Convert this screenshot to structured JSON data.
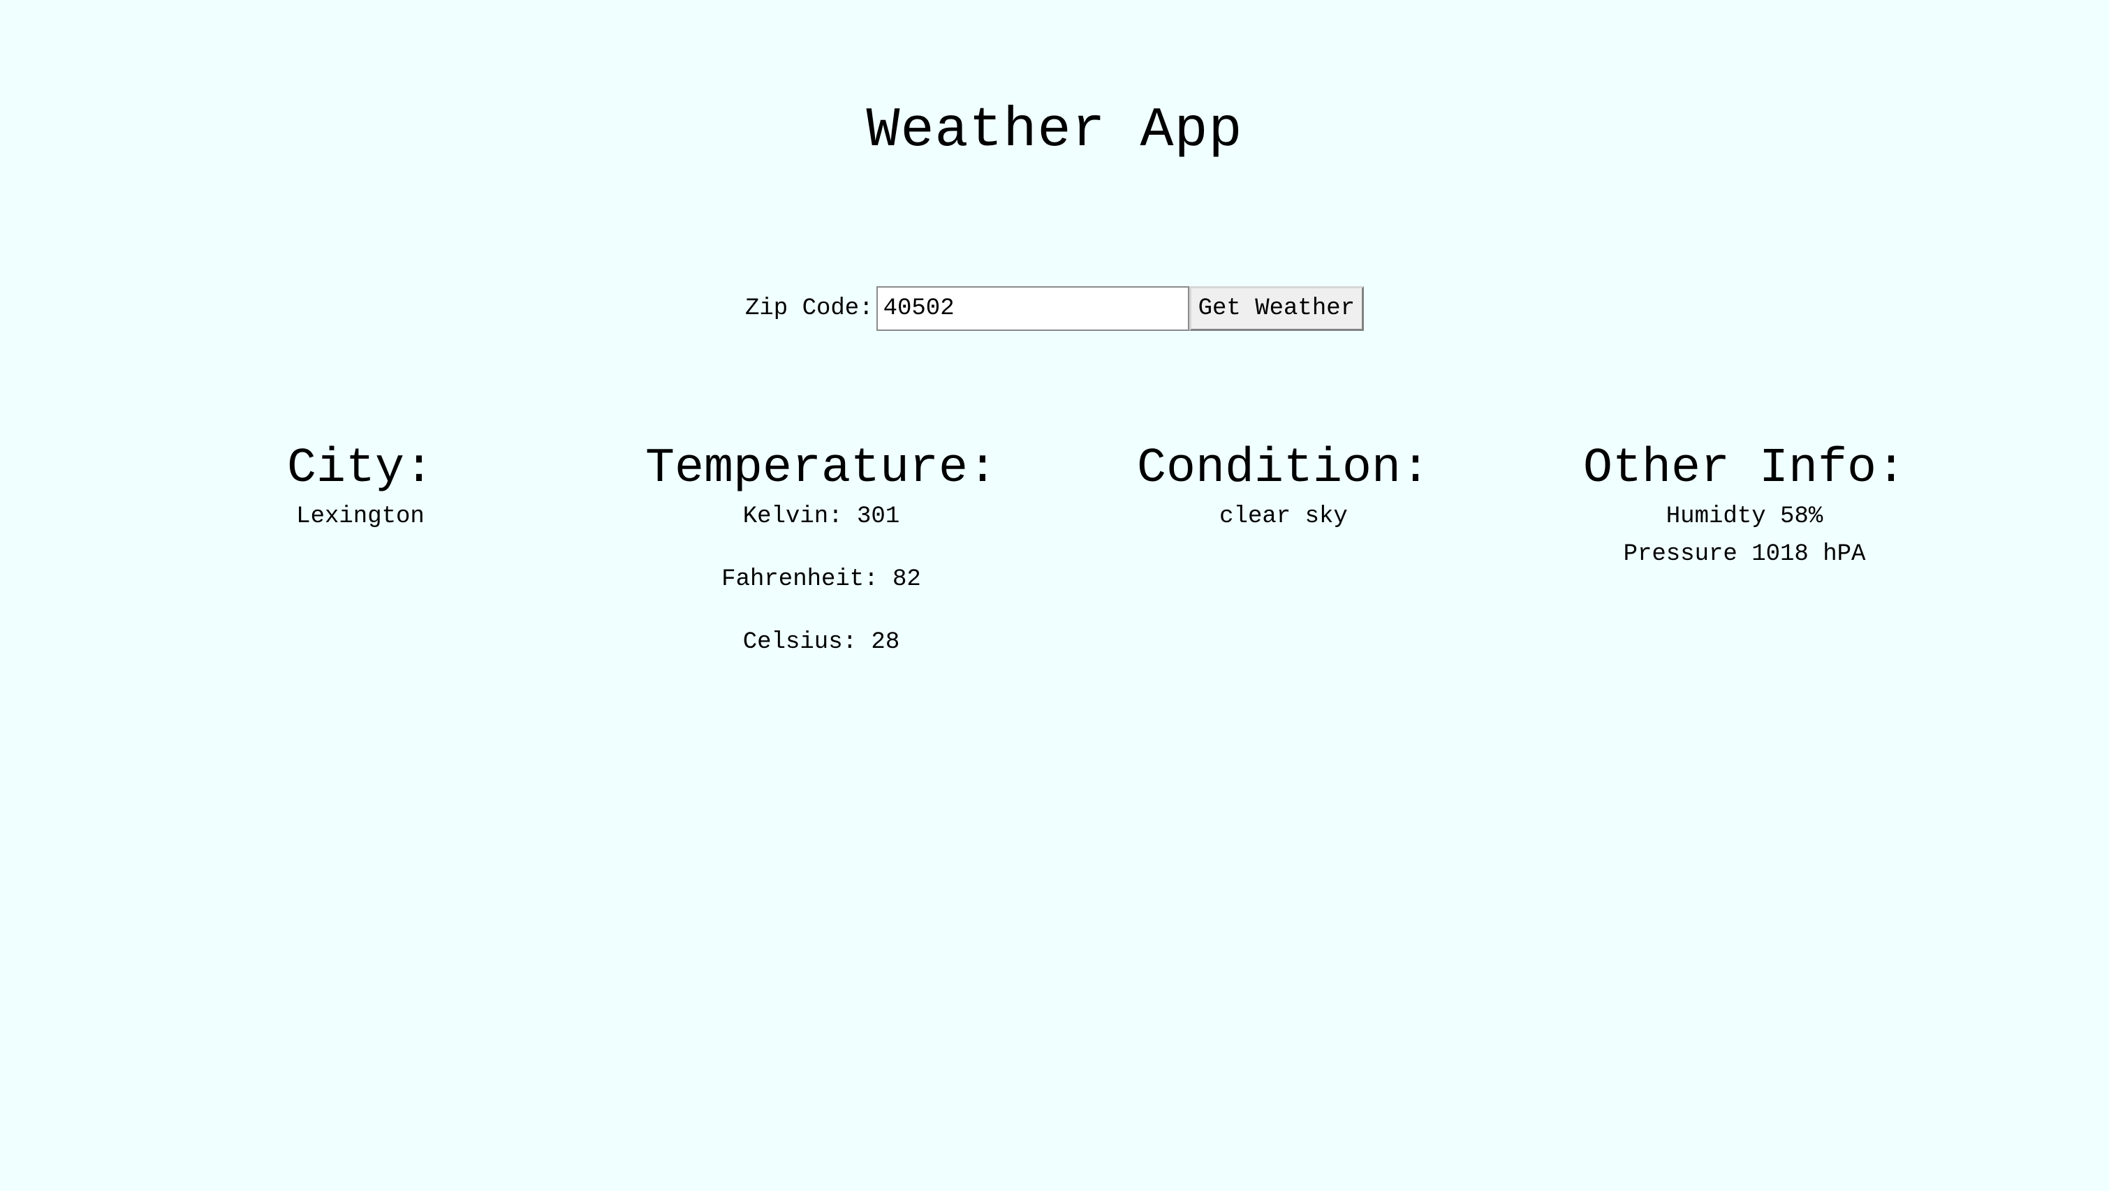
{
  "header": {
    "title": "Weather App"
  },
  "form": {
    "zip_label": "Zip Code:",
    "zip_value": "40502",
    "button_label": "Get Weather"
  },
  "city": {
    "heading": "City:",
    "value": "Lexington"
  },
  "temperature": {
    "heading": "Temperature:",
    "kelvin": "Kelvin: 301",
    "fahrenheit": "Fahrenheit: 82",
    "celsius": "Celsius: 28"
  },
  "condition": {
    "heading": "Condition:",
    "value": "clear sky"
  },
  "other": {
    "heading": "Other Info:",
    "humidity": "Humidty 58%",
    "pressure": "Pressure 1018 hPA"
  }
}
